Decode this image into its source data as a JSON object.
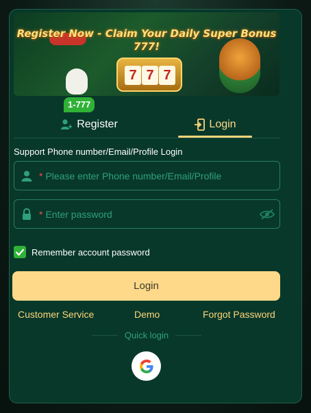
{
  "banner": {
    "headline": "Register Now - Claim Your Daily Super Bonus 777!",
    "reels": [
      "7",
      "7",
      "7"
    ]
  },
  "tabs": {
    "register_label": "Register",
    "register_badge": "1-777",
    "login_label": "Login",
    "active": "login"
  },
  "form": {
    "support_label": "Support Phone number/Email/Profile Login",
    "phone_placeholder": "Please enter Phone number/Email/Profile",
    "password_placeholder": "Enter password",
    "required_mark": "*",
    "remember_label": "Remember account password",
    "remember_checked": true,
    "login_button": "Login"
  },
  "links": {
    "customer_service": "Customer Service",
    "demo": "Demo",
    "forgot_password": "Forgot Password"
  },
  "quick_login": {
    "label": "Quick login",
    "provider_icon": "google-icon"
  },
  "colors": {
    "panel": "#08382a",
    "accent": "#ffd98a",
    "placeholder": "#2fa07c",
    "badge": "#2fb236"
  },
  "icons": {
    "register": "user-add-icon",
    "login": "login-door-icon",
    "phone_field": "user-icon",
    "password_field": "lock-icon",
    "password_toggle": "eye-off-icon",
    "checkbox": "checkmark-icon"
  }
}
